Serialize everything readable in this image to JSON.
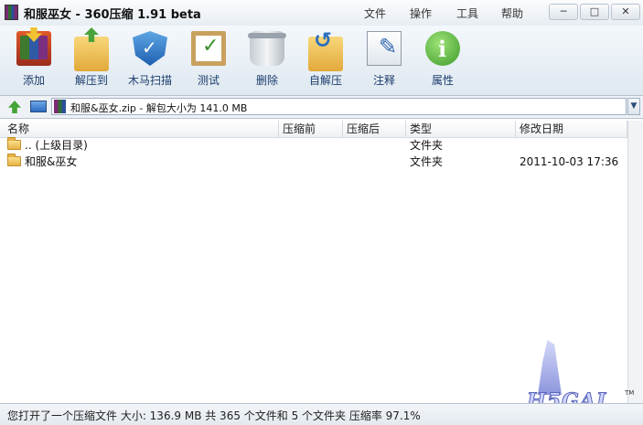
{
  "window": {
    "title": "和服巫女 - 360压缩 1.91 beta",
    "minimize": "─",
    "maximize": "□",
    "close": "✕"
  },
  "menu": [
    "文件",
    "操作",
    "工具",
    "帮助"
  ],
  "toolbar": [
    {
      "label": "添加",
      "icon": "add-archive-icon"
    },
    {
      "label": "解压到",
      "icon": "extract-folder-icon"
    },
    {
      "label": "木马扫描",
      "icon": "shield-scan-icon"
    },
    {
      "label": "测试",
      "icon": "test-checklist-icon"
    },
    {
      "label": "删除",
      "icon": "trash-icon"
    },
    {
      "label": "自解压",
      "icon": "self-extract-icon"
    },
    {
      "label": "注释",
      "icon": "comment-pencil-icon"
    },
    {
      "label": "属性",
      "icon": "info-icon"
    }
  ],
  "address": {
    "path": "和服&巫女.zip - 解包大小为 141.0 MB"
  },
  "columns": [
    "名称",
    "压缩前",
    "压缩后",
    "类型",
    "修改日期"
  ],
  "rows": [
    {
      "name": ".. (上级目录)",
      "before": "",
      "after": "",
      "type": "文件夹",
      "date": ""
    },
    {
      "name": "和服&巫女",
      "before": "",
      "after": "",
      "type": "文件夹",
      "date": "2011-10-03 17:36"
    }
  ],
  "watermark": {
    "text": "H5GAL",
    "tm": "TM"
  },
  "status": "您打开了一个压缩文件 大小: 136.9 MB 共 365 个文件和 5 个文件夹 压缩率 97.1%"
}
